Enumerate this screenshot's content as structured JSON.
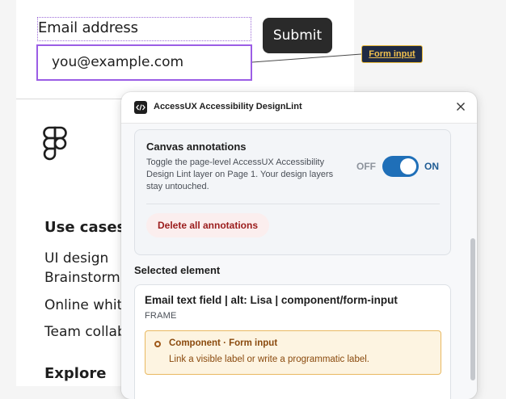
{
  "canvas": {
    "field_label": "Email address",
    "field_value": "you@example.com",
    "submit_label": "Submit",
    "annotation_tag": "Form input",
    "footer": {
      "use_cases_heading": "Use cases",
      "use_cases": [
        "UI design",
        "Brainstormi",
        "Online whit",
        "Team collab"
      ],
      "explore_heading": "Explore"
    }
  },
  "plugin": {
    "title": "AccessUX Accessibility DesignLint",
    "icon": "code-icon",
    "close_icon": "close-icon",
    "annotations_card": {
      "title": "Canvas annotations",
      "description": "Toggle the page-level AccessUX Accessibility Design Lint layer on Page 1. Your design layers stay untouched.",
      "toggle_off_label": "OFF",
      "toggle_on_label": "ON",
      "toggle_state": "on",
      "delete_button": "Delete all annotations"
    },
    "selected_label": "Selected element",
    "selected_element": {
      "name": "Email text field | alt: Lisa | component/form-input",
      "type": "FRAME",
      "issue": {
        "title": "Component · Form input",
        "description": "Link a visible label or write a programmatic label."
      }
    }
  },
  "colors": {
    "selection": "#9b5de5",
    "toggle_on": "#1f6fb8",
    "danger": "#9b1c1c",
    "warning_bg": "#fdf4e1",
    "warning_border": "#e9b961"
  }
}
